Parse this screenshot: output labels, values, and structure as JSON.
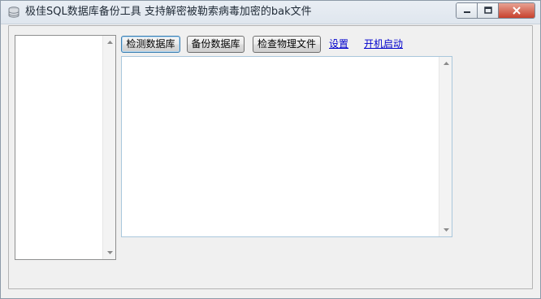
{
  "window": {
    "title": "极佳SQL数据库备份工具 支持解密被勒索病毒加密的bak文件",
    "icon": "database-icon"
  },
  "caption_buttons": {
    "minimize_icon": "minimize-icon",
    "maximize_icon": "maximize-icon",
    "close_icon": "close-icon"
  },
  "toolbar": {
    "detect_label": "检测数据库",
    "backup_label": "备份数据库",
    "check_files_label": "检查物理文件",
    "settings_link": "设置",
    "autostart_link": "开机启动"
  },
  "database_list": {
    "items": []
  },
  "log_output": {
    "value": ""
  },
  "colors": {
    "link": "#0000cc",
    "close_button": "#c7412d",
    "focus_border": "#3c7fb1"
  }
}
